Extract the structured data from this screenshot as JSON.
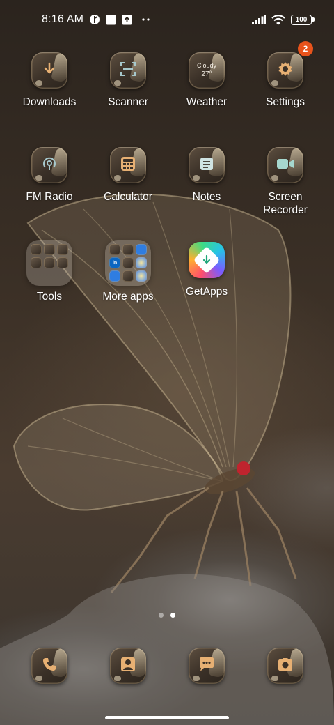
{
  "status_bar": {
    "time": "8:16 AM",
    "battery": "100",
    "icons": [
      "tidal-icon",
      "square-notification-icon",
      "upload-notification-icon",
      "more-dots-icon",
      "signal-icon",
      "wifi-icon",
      "battery-icon"
    ]
  },
  "apps": [
    {
      "label": "Downloads",
      "icon": "download-icon"
    },
    {
      "label": "Scanner",
      "icon": "scanner-icon"
    },
    {
      "label": "Weather",
      "icon": "weather-icon",
      "condition": "Cloudy",
      "temperature": "27°"
    },
    {
      "label": "Settings",
      "icon": "gear-icon",
      "badge": "2"
    },
    {
      "label": "FM Radio",
      "icon": "radio-icon"
    },
    {
      "label": "Calculator",
      "icon": "calculator-icon"
    },
    {
      "label": "Notes",
      "icon": "notes-icon"
    },
    {
      "label": "Screen Recorder",
      "icon": "video-camera-icon"
    },
    {
      "label": "Tools",
      "icon": "folder-icon"
    },
    {
      "label": "More apps",
      "icon": "folder-icon"
    },
    {
      "label": "GetApps",
      "icon": "getapps-icon"
    }
  ],
  "folders": {
    "more_apps_badges": {
      "linkedin": "in"
    }
  },
  "dock": [
    {
      "icon": "phone-icon"
    },
    {
      "icon": "contacts-icon"
    },
    {
      "icon": "messages-icon"
    },
    {
      "icon": "camera-icon"
    }
  ],
  "pages": {
    "count": 2,
    "current": 2
  },
  "colors": {
    "badge": "#e8531b",
    "icon_glyph": "#e7b073",
    "icon_tile": "#3a3027"
  }
}
